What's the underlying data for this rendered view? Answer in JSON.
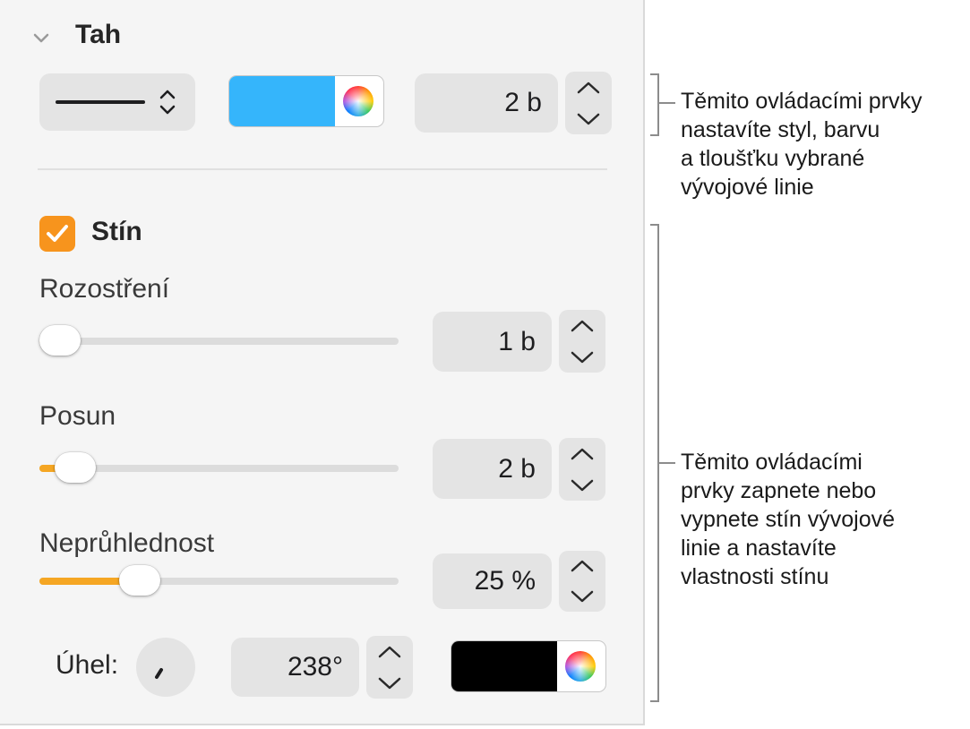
{
  "stroke": {
    "title": "Tah",
    "width_value": "2 b",
    "color_hex": "#35b5fb"
  },
  "shadow": {
    "title": "Stín",
    "checked": true,
    "blur": {
      "label": "Rozostření",
      "value": "1 b",
      "level": 0.02
    },
    "offset": {
      "label": "Posun",
      "value": "2 b",
      "level": 0.07
    },
    "opacity": {
      "label": "Neprůhlednost",
      "value": "25 %",
      "level": 0.25
    },
    "angle": {
      "label": "Úhel:",
      "value": "238°"
    },
    "color_hex": "#000000"
  },
  "callouts": {
    "stroke": "Těmito ovládacími prvky\nnastavíte styl, barvu\na tloušťku vybrané\nvývojové linie",
    "shadow": "Těmito ovládacími\nprvky zapnete nebo\nvypnete stín vývojové\nlinie a nastavíte\nvlastnosti stínu"
  },
  "colors": {
    "accent_orange": "#f7941d",
    "stroke_blue": "#35b5fb",
    "field_bg": "#e4e4e4",
    "panel_bg": "#f5f5f5"
  }
}
